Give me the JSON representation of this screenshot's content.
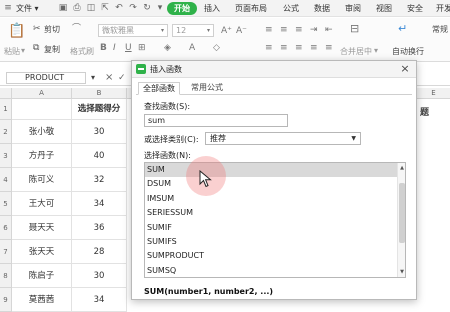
{
  "menubar": {
    "items": [
      "文件",
      "开始",
      "插入",
      "页面布局",
      "公式",
      "数据",
      "审阅",
      "视图",
      "安全",
      "开发"
    ],
    "active_tab": "开始",
    "colors": {
      "active_bg": "#2fb24a"
    }
  },
  "ribbon": {
    "cut_label": "剪切",
    "copy_label": "复制",
    "paste_label": "粘贴",
    "format_painter_label": "格式刷",
    "font_name": "微软雅黑",
    "font_size": "12",
    "merge_center_label": "合并居中",
    "wrap_text_label": "自动换行",
    "format_label": "常规"
  },
  "formula_bar": {
    "name_box": "PRODUCT",
    "cancel_icon": "×",
    "confirm_icon": "✓"
  },
  "sheet": {
    "columns": [
      "A",
      "B"
    ],
    "hidden_col_letter": "E",
    "row_numbers": [
      "1",
      "2",
      "3",
      "4",
      "5",
      "6",
      "7",
      "8",
      "9"
    ],
    "header_row": {
      "B": "选择题得分"
    },
    "rows": [
      {
        "A": "张小敬",
        "B": "30"
      },
      {
        "A": "方丹子",
        "B": "40"
      },
      {
        "A": "陈可义",
        "B": "32"
      },
      {
        "A": "王大可",
        "B": "34"
      },
      {
        "A": "聂天天",
        "B": "36"
      },
      {
        "A": "张天天",
        "B": "28"
      },
      {
        "A": "陈启子",
        "B": "30"
      },
      {
        "A": "莫茜茜",
        "B": "34"
      }
    ],
    "right_edge_header_fragment": "题"
  },
  "dialog": {
    "title": "插入函数",
    "close_icon": "×",
    "tabs": [
      "全部函数",
      "常用公式"
    ],
    "active_tab": "全部函数",
    "search_label": "查找函数(S):",
    "search_value": "sum",
    "category_label": "或选择类别(C):",
    "category_value": "推荐",
    "list_label": "选择函数(N):",
    "functions": [
      "SUM",
      "DSUM",
      "IMSUM",
      "SERIESSUM",
      "SUMIF",
      "SUMIFS",
      "SUMPRODUCT",
      "SUMSQ"
    ],
    "selected_function": "SUM",
    "signature": "SUM(number1, number2, ...)"
  }
}
